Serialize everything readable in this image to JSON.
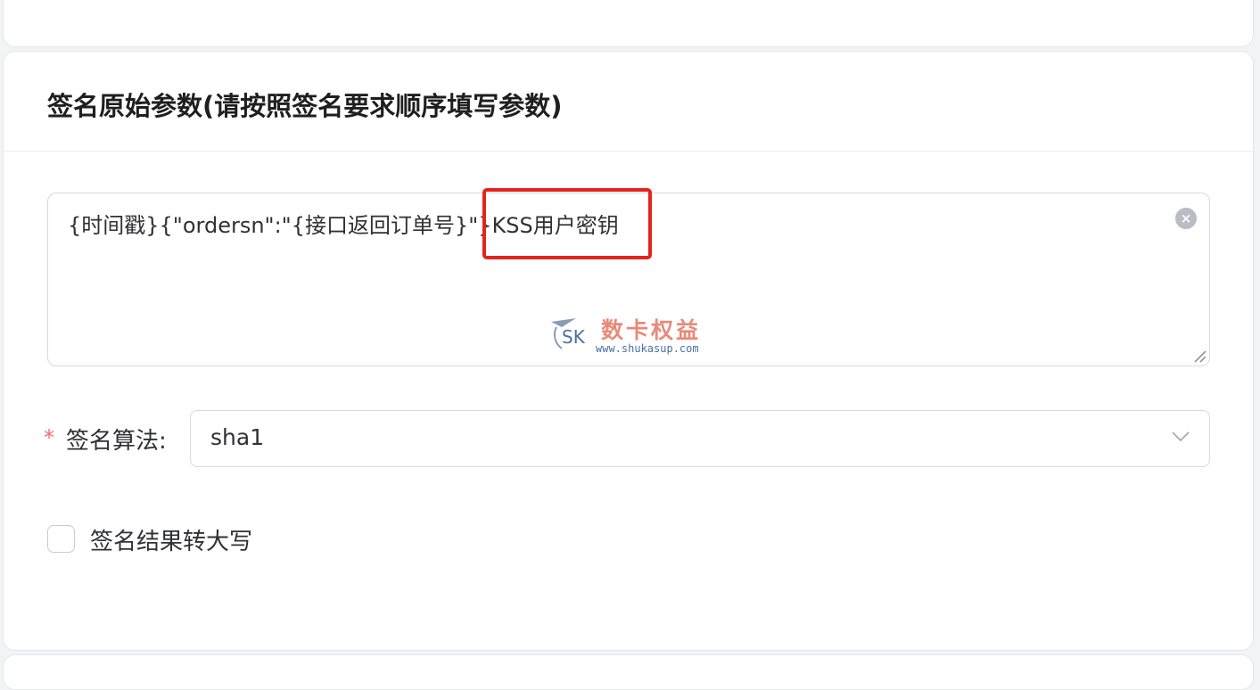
{
  "section": {
    "title": "签名原始参数(请按照签名要求顺序填写参数)"
  },
  "params_textarea": {
    "value": "{时间戳}{\"ordersn\":\"{接口返回订单号}\"}KSS用户密钥"
  },
  "watermark": {
    "logo_text": "SK",
    "brand_cn": "数卡权益",
    "url": "www.shukasup.com"
  },
  "algorithm": {
    "required_mark": "*",
    "label": "签名算法:",
    "selected": "sha1"
  },
  "uppercase_option": {
    "label": "签名结果转大写",
    "checked": false
  },
  "icons": {
    "clear": "clear-icon",
    "dropdown": "chevron-down-icon",
    "resize": "resize-handle-icon"
  },
  "colors": {
    "highlight": "#e3241d",
    "required": "#f56c6c",
    "border": "#d9d9d9"
  }
}
